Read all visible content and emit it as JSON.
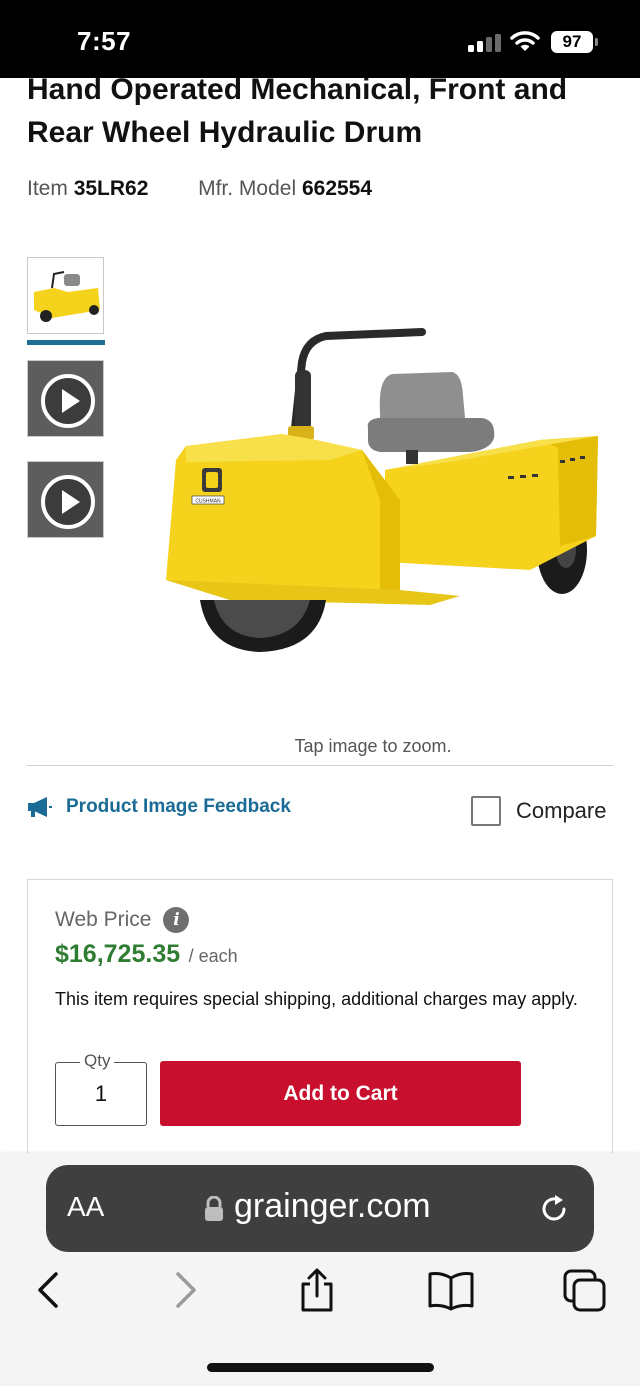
{
  "status_bar": {
    "time": "7:57",
    "battery": "97"
  },
  "product": {
    "title": "Hand Operated Mechanical, Front and Rear Wheel Hydraulic Drum",
    "item_label": "Item",
    "item_number": "35LR62",
    "model_label": "Mfr. Model",
    "model_number": "662554",
    "brand_badge": "CUSHMAN"
  },
  "gallery": {
    "thumbnails": [
      "image",
      "video",
      "video"
    ],
    "zoom_hint": "Tap image to zoom."
  },
  "feedback": {
    "label": "Product Image Feedback"
  },
  "compare": {
    "label": "Compare",
    "checked": false
  },
  "pricing": {
    "label": "Web Price",
    "price": "$16,725.35",
    "unit": "/ each",
    "shipping_note": "This item requires special shipping, additional charges may apply.",
    "qty_label": "Qty",
    "qty_value": "1",
    "add_to_cart": "Add to Cart"
  },
  "browser": {
    "aa_label": "AA",
    "url": "grainger.com",
    "nav": [
      "back-icon",
      "forward-icon",
      "share-icon",
      "bookmarks-icon",
      "tabs-icon"
    ]
  },
  "colors": {
    "link": "#1a6b95",
    "price": "#2e7d32",
    "cart_button": "#c8102e",
    "vehicle_yellow": "#f5d21c"
  }
}
